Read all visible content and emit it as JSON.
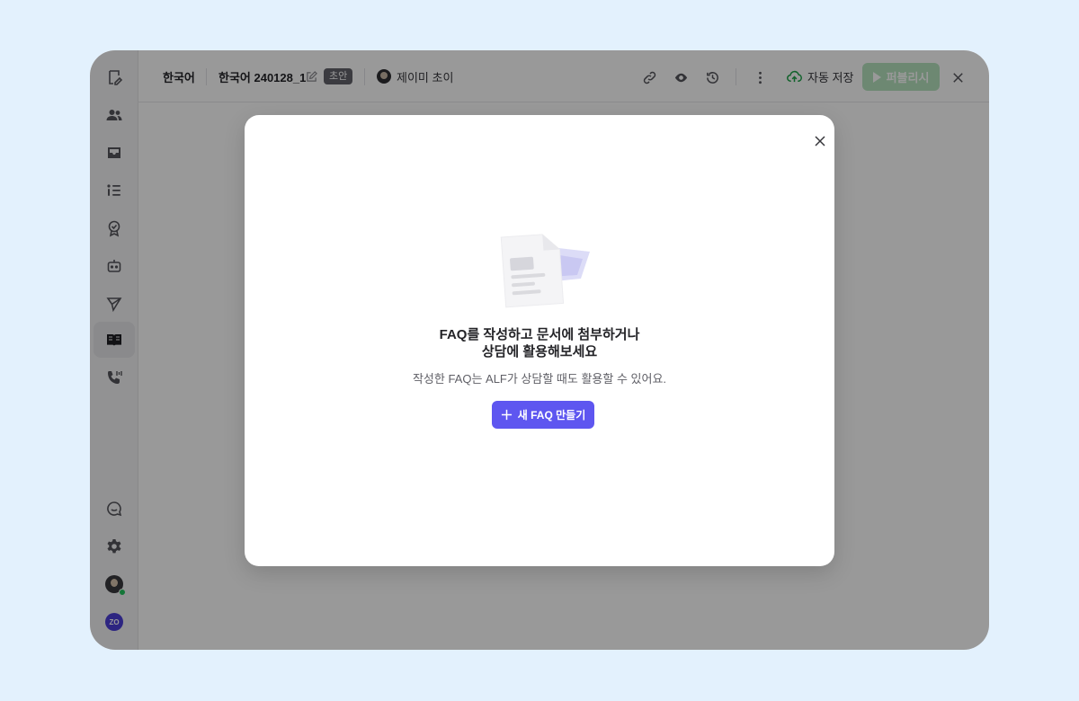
{
  "topbar": {
    "language": "한국어",
    "doc_title": "한국어 240128_1",
    "status_badge": "초안",
    "author": "제이미 초이",
    "autosave_label": "자동 저장",
    "publish_label": "퍼블리시"
  },
  "sidebar": {
    "items": [
      {
        "icon": "document-edit-icon"
      },
      {
        "icon": "users-icon"
      },
      {
        "icon": "inbox-icon"
      },
      {
        "icon": "list-icon"
      },
      {
        "icon": "badge-check-icon"
      },
      {
        "icon": "robot-icon"
      },
      {
        "icon": "send-icon"
      },
      {
        "icon": "book-icon",
        "active": true
      },
      {
        "icon": "phone-icon"
      }
    ],
    "bottom": [
      {
        "icon": "chat-smile-icon"
      },
      {
        "icon": "gear-icon"
      },
      {
        "icon": "user-avatar"
      },
      {
        "icon": "zo-logo"
      }
    ]
  },
  "modal": {
    "title_line1": "FAQ를 작성하고 문서에 첨부하거나",
    "title_line2": "상담에 활용해보세요",
    "subtitle": "작성한 FAQ는 ALF가 상담할 때도 활용할 수 있어요.",
    "button_label": "새 FAQ 만들기"
  },
  "colors": {
    "primary": "#5e56f0",
    "publish_disabled": "#b6e3bf",
    "online_status": "#22c55e"
  }
}
